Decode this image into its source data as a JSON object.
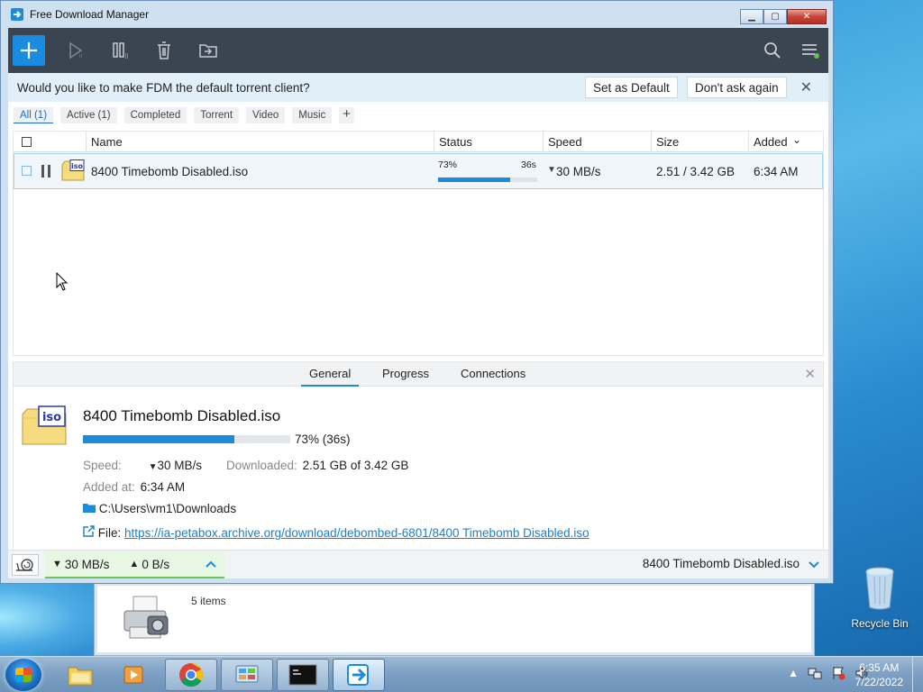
{
  "window": {
    "title": "Free Download Manager",
    "min_glyph": "▁",
    "max_glyph": "▢",
    "close_glyph": "✕"
  },
  "banner": {
    "text": "Would you like to make FDM the default torrent client?",
    "set_default": "Set as Default",
    "dont_ask": "Don't ask again",
    "close_glyph": "✕"
  },
  "filters": {
    "items": [
      "All (1)",
      "Active (1)",
      "Completed",
      "Torrent",
      "Video",
      "Music"
    ],
    "add": "+"
  },
  "table": {
    "headers": {
      "name": "Name",
      "status": "Status",
      "speed": "Speed",
      "size": "Size",
      "added": "Added"
    },
    "sort_indicator": "⌄",
    "rows": [
      {
        "name": "8400 Timebomb Disabled.iso",
        "percent_label": "73%",
        "progress": 0.73,
        "time_left": "36s",
        "speed": "30 MB/s",
        "size": "2.51 / 3.42 GB",
        "added": "6:34 AM",
        "icon_label": "iso"
      }
    ]
  },
  "details": {
    "tabs": [
      "General",
      "Progress",
      "Connections"
    ],
    "name": "8400 Timebomb Disabled.iso",
    "progress": 0.73,
    "progress_text": "73% (36s)",
    "speed_label": "Speed:",
    "speed_value": "30 MB/s",
    "downloaded_label": "Downloaded:",
    "downloaded_value": "2.51 GB of 3.42 GB",
    "added_label": "Added at:",
    "added_value": "6:34 AM",
    "folder": "C:\\Users\\vm1\\Downloads",
    "file_label": "File:",
    "file_url": "https://ia-petabox.archive.org/download/debombed-6801/8400 Timebomb Disabled.iso"
  },
  "statusbar": {
    "down_speed": "30 MB/s",
    "up_speed": "0 B/s",
    "current_file": "8400 Timebomb Disabled.iso"
  },
  "desktop": {
    "explorer_count": "5 items",
    "recycle_bin": "Recycle Bin"
  },
  "taskbar": {
    "time": "6:35 AM",
    "date": "7/22/2022"
  },
  "colors": {
    "accent": "#1c8bdb",
    "toolbar": "#3b4552",
    "banner": "#e1f0f8",
    "status_green": "#6cc45b"
  }
}
